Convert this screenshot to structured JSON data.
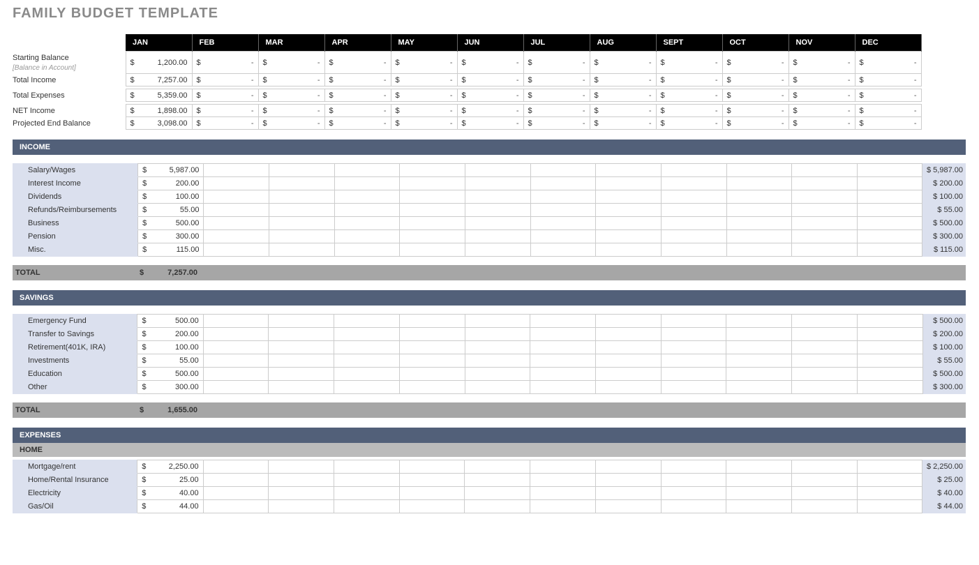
{
  "title": "FAMILY BUDGET TEMPLATE",
  "currency": "$",
  "dash": "-",
  "months": [
    "JAN",
    "FEB",
    "MAR",
    "APR",
    "MAY",
    "JUN",
    "JUL",
    "AUG",
    "SEPT",
    "OCT",
    "NOV",
    "DEC"
  ],
  "summary": {
    "starting_balance_label": "Starting Balance",
    "starting_balance_sub": "[Balance in Account]",
    "total_income_label": "Total Income",
    "total_expenses_label": "Total Expenses",
    "net_income_label": "NET Income",
    "projected_end_label": "Projected End Balance",
    "starting_balance_jan": "1,200.00",
    "total_income_jan": "7,257.00",
    "total_expenses_jan": "5,359.00",
    "net_income_jan": "1,898.00",
    "projected_end_jan": "3,098.00"
  },
  "income": {
    "header": "INCOME",
    "total_label": "TOTAL",
    "total_jan": "7,257.00",
    "rows": [
      {
        "label": "Salary/Wages",
        "jan": "5,987.00",
        "total": "$ 5,987.00"
      },
      {
        "label": "Interest Income",
        "jan": "200.00",
        "total": "$    200.00"
      },
      {
        "label": "Dividends",
        "jan": "100.00",
        "total": "$    100.00"
      },
      {
        "label": "Refunds/Reimbursements",
        "jan": "55.00",
        "total": "$      55.00"
      },
      {
        "label": "Business",
        "jan": "500.00",
        "total": "$    500.00"
      },
      {
        "label": "Pension",
        "jan": "300.00",
        "total": "$    300.00"
      },
      {
        "label": "Misc.",
        "jan": "115.00",
        "total": "$    115.00"
      }
    ]
  },
  "savings": {
    "header": "SAVINGS",
    "total_label": "TOTAL",
    "total_jan": "1,655.00",
    "rows": [
      {
        "label": "Emergency Fund",
        "jan": "500.00",
        "total": "$    500.00"
      },
      {
        "label": "Transfer to Savings",
        "jan": "200.00",
        "total": "$    200.00"
      },
      {
        "label": "Retirement(401K, IRA)",
        "jan": "100.00",
        "total": "$    100.00"
      },
      {
        "label": "Investments",
        "jan": "55.00",
        "total": "$      55.00"
      },
      {
        "label": "Education",
        "jan": "500.00",
        "total": "$    500.00"
      },
      {
        "label": "Other",
        "jan": "300.00",
        "total": "$    300.00"
      }
    ]
  },
  "expenses": {
    "header": "EXPENSES",
    "sub_header": "HOME",
    "rows": [
      {
        "label": "Mortgage/rent",
        "jan": "2,250.00",
        "total": "$ 2,250.00"
      },
      {
        "label": "Home/Rental Insurance",
        "jan": "25.00",
        "total": "$      25.00"
      },
      {
        "label": "Electricity",
        "jan": "40.00",
        "total": "$      40.00"
      },
      {
        "label": "Gas/Oil",
        "jan": "44.00",
        "total": "$      44.00"
      }
    ]
  }
}
